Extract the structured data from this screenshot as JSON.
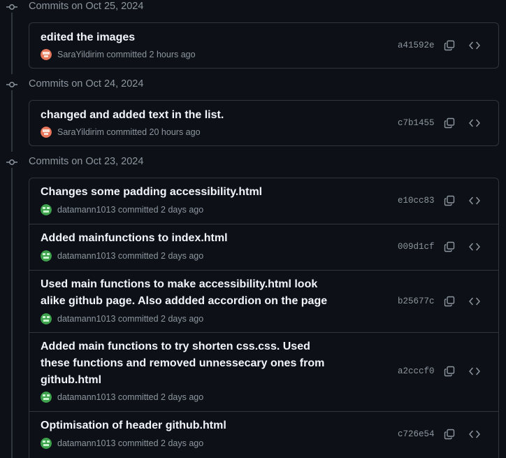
{
  "groups": [
    {
      "title": "Commits on Oct 25, 2024",
      "commits": [
        {
          "message": "edited the images",
          "author": "SaraYildirim",
          "verb": "committed",
          "time": "2 hours ago",
          "sha": "a41592e",
          "avatar": "sara"
        }
      ]
    },
    {
      "title": "Commits on Oct 24, 2024",
      "commits": [
        {
          "message": "changed and added text in the list.",
          "author": "SaraYildirim",
          "verb": "committed",
          "time": "20 hours ago",
          "sha": "c7b1455",
          "avatar": "sara"
        }
      ]
    },
    {
      "title": "Commits on Oct 23, 2024",
      "commits": [
        {
          "message": "Changes some padding accessibility.html",
          "author": "datamann1013",
          "verb": "committed",
          "time": "2 days ago",
          "sha": "e10cc83",
          "avatar": "datamann"
        },
        {
          "message": "Added mainfunctions to index.html",
          "author": "datamann1013",
          "verb": "committed",
          "time": "2 days ago",
          "sha": "009d1cf",
          "avatar": "datamann"
        },
        {
          "message": "Used main functions to make accessibility.html look alike github page. Also addded accordion on the page",
          "author": "datamann1013",
          "verb": "committed",
          "time": "2 days ago",
          "sha": "b25677c",
          "avatar": "datamann"
        },
        {
          "message": "Added main functions to try shorten css.css. Used these functions and removed unnessecary ones from github.html",
          "author": "datamann1013",
          "verb": "committed",
          "time": "2 days ago",
          "sha": "a2cccf0",
          "avatar": "datamann"
        },
        {
          "message": "Optimisation of header github.html",
          "author": "datamann1013",
          "verb": "committed",
          "time": "2 days ago",
          "sha": "c726e54",
          "avatar": "datamann"
        }
      ]
    }
  ],
  "icons": {
    "commit_node": "git-commit-icon",
    "copy": "copy-icon",
    "browse": "code-icon"
  },
  "colors": {
    "background": "#0d1117",
    "border": "#30363d",
    "muted_text": "#8d96a0",
    "title_text": "#f0f6fc",
    "avatar_sara": "#e8765a",
    "avatar_datamann": "#3fa34d"
  }
}
